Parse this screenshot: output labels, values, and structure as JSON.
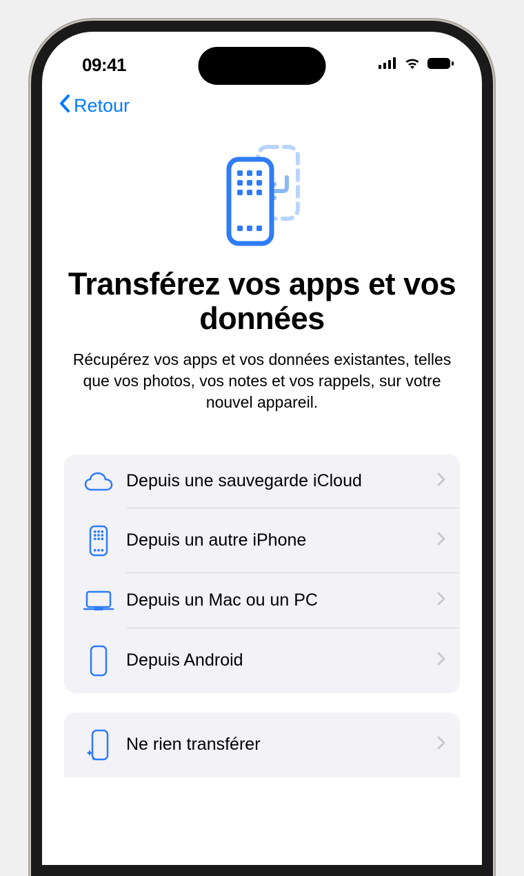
{
  "statusBar": {
    "time": "09:41"
  },
  "nav": {
    "backLabel": "Retour"
  },
  "header": {
    "title": "Transférez vos apps et vos données",
    "subtitle": "Récupérez vos apps et vos données existantes, telles que vos photos, vos notes et vos rappels, sur votre nouvel appareil."
  },
  "options": [
    {
      "icon": "cloud",
      "label": "Depuis une sauvegarde iCloud"
    },
    {
      "icon": "phone-grid",
      "label": "Depuis un autre iPhone"
    },
    {
      "icon": "laptop",
      "label": "Depuis un Mac ou un PC"
    },
    {
      "icon": "phone-outline",
      "label": "Depuis Android"
    }
  ],
  "secondaryOption": {
    "icon": "phone-sparkle",
    "label": "Ne rien transférer"
  },
  "colors": {
    "accent": "#007aff",
    "listBg": "#f2f2f7",
    "chevron": "#c7c7cc"
  }
}
